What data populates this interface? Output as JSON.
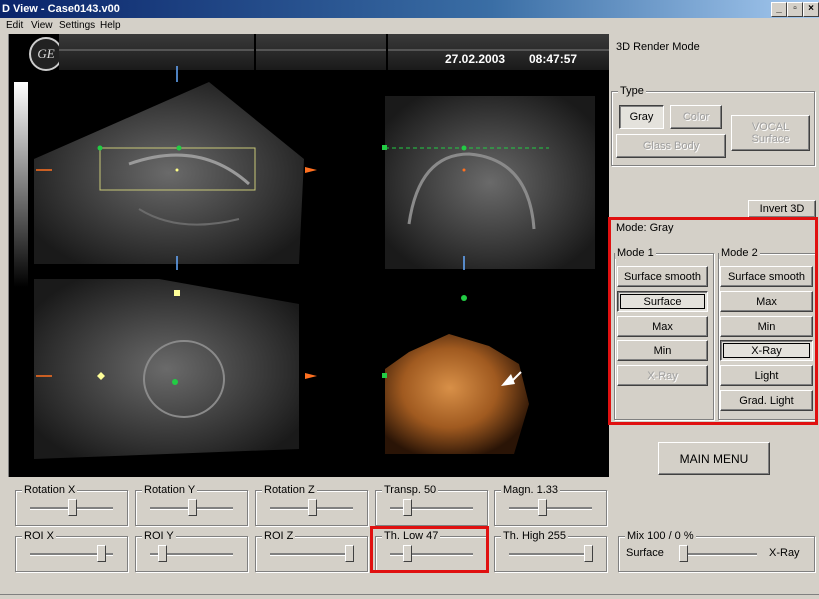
{
  "window": {
    "title": "D View - Case0143.v00"
  },
  "menu": {
    "edit": "Edit",
    "view": "View",
    "settings": "Settings",
    "help": "Help"
  },
  "viewer": {
    "date": "27.02.2003",
    "time": "08:47:57",
    "logo": "GE"
  },
  "render": {
    "mode_title": "3D Render Mode",
    "type_label": "Type",
    "gray": "Gray",
    "color": "Color",
    "vocal": "VOCAL Surface",
    "glass_body": "Glass Body",
    "invert_3d": "Invert 3D",
    "mode_label": "Mode: Gray",
    "mode1": {
      "label": "Mode 1",
      "buttons": [
        "Surface smooth",
        "Surface",
        "Max",
        "Min",
        "X-Ray"
      ]
    },
    "mode2": {
      "label": "Mode 2",
      "buttons": [
        "Surface smooth",
        "Max",
        "Min",
        "X-Ray",
        "Light",
        "Grad. Light"
      ]
    },
    "main_menu": "MAIN MENU"
  },
  "sliders": {
    "rotation_x": {
      "label": "Rotation X",
      "value": 0.5
    },
    "rotation_y": {
      "label": "Rotation Y",
      "value": 0.5
    },
    "rotation_z": {
      "label": "Rotation Z",
      "value": 0.5
    },
    "transp": {
      "label": "Transp. 50",
      "value": 0.2
    },
    "magn": {
      "label": "Magn. 1.33",
      "value": 0.4
    },
    "roi_x": {
      "label": "ROI X",
      "value": 0.85
    },
    "roi_y": {
      "label": "ROI Y",
      "value": 0.15
    },
    "roi_z": {
      "label": "ROI Z",
      "value": 0.95
    },
    "th_low": {
      "label": "Th. Low 47",
      "value": 0.2
    },
    "th_high": {
      "label": "Th. High 255",
      "value": 0.95
    },
    "mix": {
      "label": "Mix 100 / 0 %",
      "left": "Surface",
      "right": "X-Ray",
      "value": 0.05
    }
  },
  "colors": {
    "highlight": "#e01010",
    "roi_box": "#c8c878",
    "marker": "#22cc44",
    "orange": "#ff7020"
  }
}
